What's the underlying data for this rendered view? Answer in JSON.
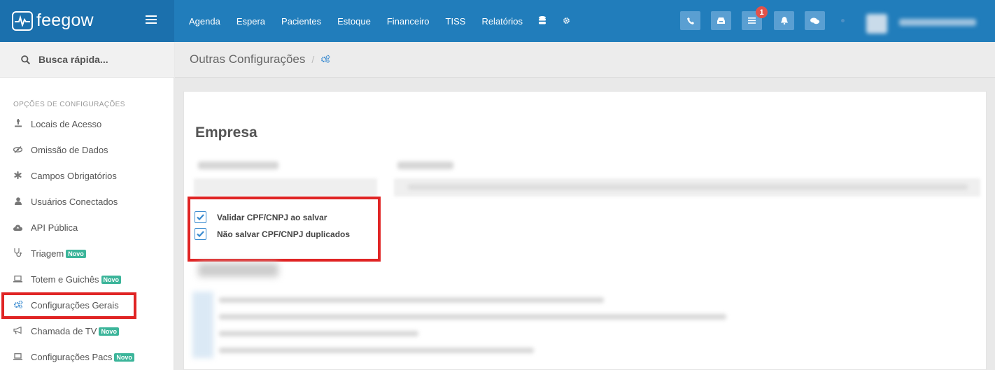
{
  "brand": {
    "name": "feegow"
  },
  "nav": {
    "items": [
      "Agenda",
      "Espera",
      "Pacientes",
      "Estoque",
      "Financeiro",
      "TISS",
      "Relatórios"
    ],
    "icons": [
      "database-icon",
      "gear-icon"
    ]
  },
  "toolbar": {
    "buttons": [
      "phone-icon",
      "inbox-icon",
      "list-icon",
      "bell-icon",
      "chat-icon"
    ],
    "notification_count": "1"
  },
  "sidebar": {
    "search_placeholder": "Busca rápida...",
    "section_label": "OPÇÕES DE CONFIGURAÇÕES",
    "new_tag": "Novo",
    "items": [
      {
        "label": "Locais de Acesso",
        "icon": "map-pin-icon",
        "new": false
      },
      {
        "label": "Omissão de Dados",
        "icon": "eye-slash-icon",
        "new": false
      },
      {
        "label": "Campos Obrigatórios",
        "icon": "asterisk-icon",
        "new": false
      },
      {
        "label": "Usuários Conectados",
        "icon": "user-icon",
        "new": false
      },
      {
        "label": "API Pública",
        "icon": "cloud-icon",
        "new": false
      },
      {
        "label": "Triagem",
        "icon": "stethoscope-icon",
        "new": true
      },
      {
        "label": "Totem e Guichês",
        "icon": "laptop-icon",
        "new": true
      },
      {
        "label": "Configurações Gerais",
        "icon": "cogs-icon",
        "new": false
      },
      {
        "label": "Chamada de TV",
        "icon": "bullhorn-icon",
        "new": true
      },
      {
        "label": "Configurações Pacs",
        "icon": "laptop-icon",
        "new": true
      }
    ]
  },
  "breadcrumb": {
    "title": "Outras Configurações",
    "separator": "/"
  },
  "main": {
    "section_title": "Empresa",
    "checkboxes": [
      {
        "label": "Validar CPF/CNPJ ao salvar",
        "checked": true
      },
      {
        "label": "Não salvar CPF/CNPJ duplicados",
        "checked": true
      }
    ]
  },
  "colors": {
    "topbar": "#217dbb",
    "brand_bg": "#1b70ad",
    "accent": "#3a8bd0",
    "highlight": "#e02424",
    "badge": "#e2524a",
    "new_tag": "#3cb59a"
  }
}
